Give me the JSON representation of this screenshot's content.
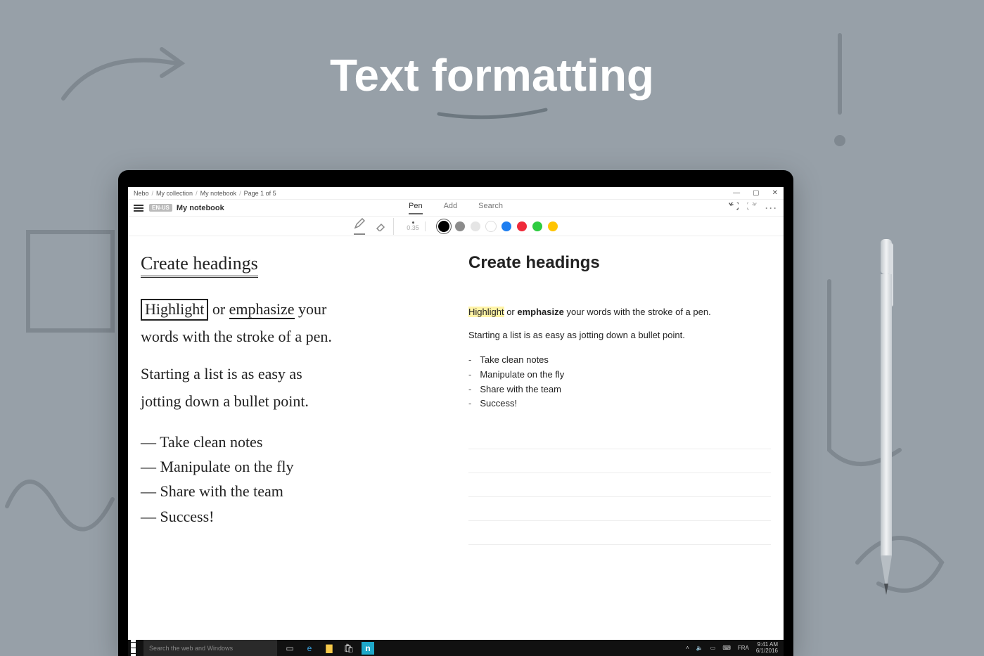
{
  "promo": {
    "title": "Text formatting"
  },
  "breadcrumb": [
    "Nebo",
    "My collection",
    "My notebook",
    "Page 1 of 5"
  ],
  "window": {
    "lang_badge": "EN-US",
    "notebook_title": "My notebook"
  },
  "tabs": {
    "pen": "Pen",
    "add": "Add",
    "search": "Search",
    "active": "pen"
  },
  "penbar": {
    "stroke_label": "0.35",
    "colors": [
      "#000000",
      "#8c8c8c",
      "#e5e5e5",
      "#ffffff",
      "#1e7ef0",
      "#ef2a3a",
      "#2ecc40",
      "#ffc400"
    ],
    "selected_index": 0
  },
  "handwritten": {
    "heading": "Create headings",
    "para1_parts": {
      "highlight": "Highlight",
      "or": " or ",
      "emphasize": "emphasize",
      "rest1": " your",
      "rest2": "words with the stroke of a pen."
    },
    "para2a": "Starting a list is as easy as",
    "para2b": "jotting down a bullet point.",
    "list": [
      "— Take clean notes",
      "— Manipulate on the fly",
      "— Share with the team",
      "— Success!"
    ]
  },
  "typed": {
    "heading": "Create headings",
    "p1_hl": "Highlight",
    "p1_mid": " or ",
    "p1_em": "emphasize",
    "p1_rest": " your words with the stroke of a pen.",
    "p2": "Starting a list is as easy as jotting down a bullet point.",
    "list": [
      "Take clean notes",
      "Manipulate on the fly",
      "Share with the team",
      "Success!"
    ]
  },
  "taskbar": {
    "search_placeholder": "Search the web and Windows",
    "lang": "FRA",
    "time": "9:41 AM",
    "date": "6/1/2016"
  }
}
